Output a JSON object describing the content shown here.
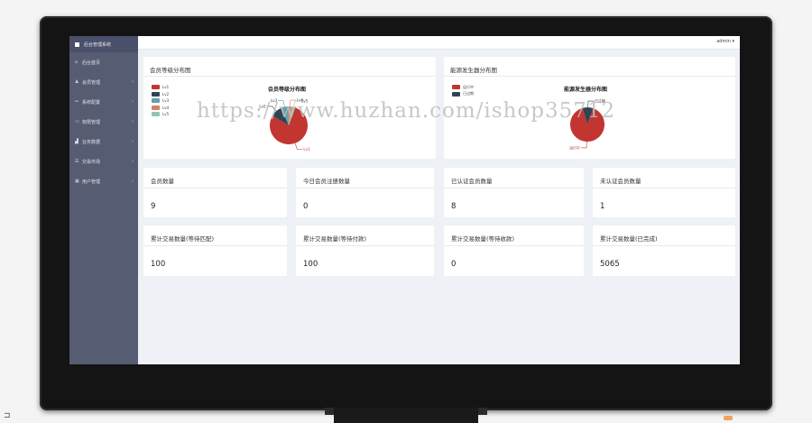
{
  "sidebar": {
    "title": "后台管理系统",
    "items": [
      {
        "icon": "home-icon",
        "glyph": "⌂",
        "label": "后台首页",
        "has_children": false
      },
      {
        "icon": "user-icon",
        "glyph": "♟",
        "label": "会员管理",
        "has_children": true
      },
      {
        "icon": "share-icon",
        "glyph": "⚯",
        "label": "系统配置",
        "has_children": true
      },
      {
        "icon": "inbox-icon",
        "glyph": "▭",
        "label": "权限管理",
        "has_children": true
      },
      {
        "icon": "chart-icon",
        "glyph": "▟",
        "label": "业务数据",
        "has_children": true
      },
      {
        "icon": "list-icon",
        "glyph": "☰",
        "label": "交易市场",
        "has_children": true
      },
      {
        "icon": "grid-icon",
        "glyph": "▦",
        "label": "用户管理",
        "has_children": true
      }
    ]
  },
  "header": {
    "user": "admin",
    "caret": "▾"
  },
  "charts": [
    {
      "panel_title": "会员等级分布图",
      "chart_data": {
        "type": "pie",
        "title": "会员等级分布图",
        "categories": [
          "Lv1",
          "Lv2",
          "Lv3",
          "Lv4",
          "Lv5"
        ],
        "values": [
          78,
          10,
          6,
          3,
          3
        ],
        "colors": [
          "#c23531",
          "#2f4554",
          "#61a0a8",
          "#d48265",
          "#91c7ae"
        ],
        "legend": "top-left",
        "slice_labels": [
          "Lv1",
          "Lv2",
          "Lv3",
          "Lv4",
          "Lv5"
        ]
      }
    },
    {
      "panel_title": "能源发生器分布图",
      "chart_data": {
        "type": "pie",
        "title": "能源发生器分布图",
        "categories": [
          "运行中",
          "已过期"
        ],
        "values": [
          90,
          10
        ],
        "colors": [
          "#c23531",
          "#2f4554"
        ],
        "legend": "top-left",
        "slice_labels": [
          "运行中",
          "已过期"
        ]
      }
    }
  ],
  "stats_row1": [
    {
      "label": "会员数量",
      "value": "9"
    },
    {
      "label": "今日会员注册数量",
      "value": "0"
    },
    {
      "label": "已认证会员数量",
      "value": "8"
    },
    {
      "label": "未认证会员数量",
      "value": "1"
    }
  ],
  "stats_row2": [
    {
      "label": "累计交易数量(等待匹配)",
      "value": "100"
    },
    {
      "label": "累计交易数量(等待付款)",
      "value": "100"
    },
    {
      "label": "累计交易数量(等待收款)",
      "value": "0"
    },
    {
      "label": "累计交易数量(已完成)",
      "value": "5065"
    }
  ],
  "watermark": "https://www.huzhan.com/ishop35712",
  "corner_glyph": "⊐"
}
